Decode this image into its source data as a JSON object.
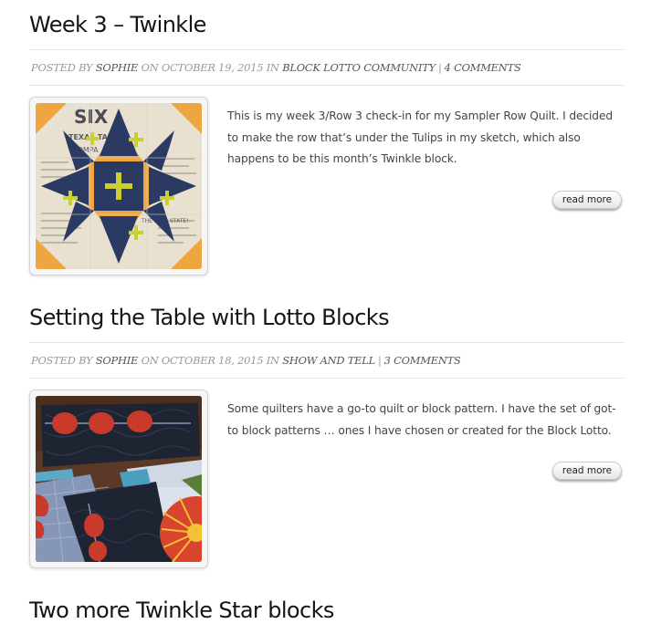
{
  "posts": [
    {
      "title": "Week 3 – Twinkle",
      "posted_by_label": "Posted by",
      "author": "Sophie",
      "on_label": "on",
      "date": "October 19, 2015",
      "in_label": "in",
      "category": "Block Lotto Community",
      "separator": "|",
      "comments": "4 Comments",
      "excerpt": "This is my week 3/Row 3 check-in for my Sampler Row Quilt. I decided to make the row that’s under the Tulips in my sketch, which also happens to be this month’s Twinkle block.",
      "read_more": "read more",
      "image_text": {
        "six": "SIX",
        "texas": "TEXAS TAMA",
        "company": "COMPA",
        "star": "THE STAR STATE!"
      }
    },
    {
      "title": "Setting the Table with Lotto Blocks",
      "posted_by_label": "Posted by",
      "author": "Sophie",
      "on_label": "on",
      "date": "October 18, 2015",
      "in_label": "in",
      "category": "Show and Tell",
      "separator": "|",
      "comments": "3 Comments",
      "excerpt": "Some quilters have a go-to quilt or block pattern. I have the set of got-to block patterns … ones I have chosen or created for the Block Lotto.",
      "read_more": "read more"
    },
    {
      "title": "Two more Twinkle Star blocks"
    }
  ],
  "colors": {
    "title": "#151515",
    "meta": "#999999",
    "meta_link": "#555555",
    "navy": "#2b3a62",
    "orange": "#efa641",
    "lime": "#c8d033",
    "red": "#cc3a2a"
  }
}
